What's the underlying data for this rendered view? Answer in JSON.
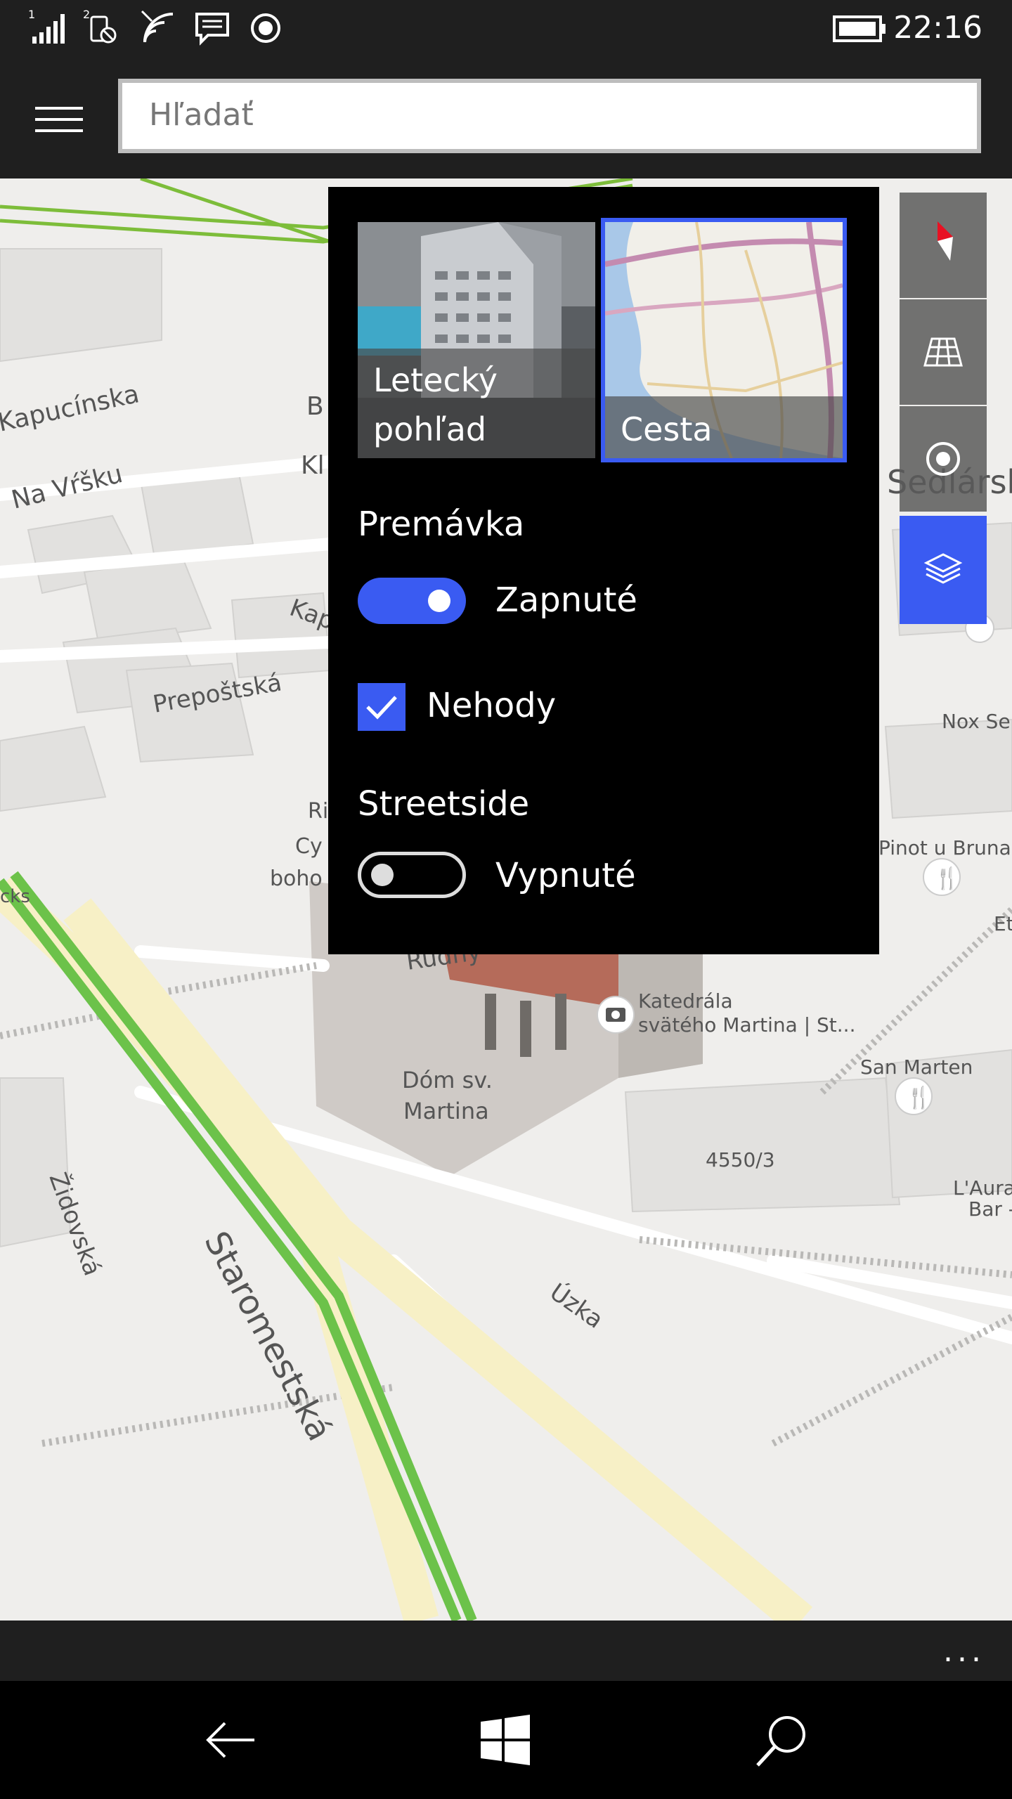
{
  "status": {
    "sim1": "1",
    "sim2": "2",
    "time": "22:16"
  },
  "search": {
    "placeholder": "Hľadať"
  },
  "panel": {
    "tiles": [
      {
        "label_line1": "Letecký",
        "label_line2": "pohľad",
        "selected": false
      },
      {
        "label": "Cesta",
        "selected": true
      }
    ],
    "traffic": {
      "title": "Premávka",
      "toggle_state": "on",
      "toggle_label": "Zapnuté"
    },
    "incidents": {
      "label": "Nehody",
      "checked": true
    },
    "streetside": {
      "title": "Streetside",
      "toggle_state": "off",
      "toggle_label": "Vypnuté"
    }
  },
  "map": {
    "labels": [
      "Kapucínska",
      "Na Vŕšku",
      "Prepoštská",
      "Kap",
      "Kl",
      "B",
      "Ri",
      "Cy",
      "boho",
      "cks",
      "Židovská",
      "Staromestská",
      "Úzka",
      "Dóm sv.",
      "Martina",
      "Katedrála",
      "svätého Martina | St...",
      "4550/3",
      "San Marten",
      "L'Aura",
      "Bar -",
      "Pinot u Bruna",
      "Nox Se",
      "Sedlárska",
      "Et",
      "Rudny"
    ]
  },
  "icons": {
    "menu": "hamburger-icon",
    "compass": "compass-icon",
    "tilt": "3d-grid-icon",
    "locate": "locate-icon",
    "layers": "layers-icon",
    "back": "back-arrow-icon",
    "start": "windows-start-icon",
    "search": "search-icon",
    "more": "more-icon"
  },
  "colors": {
    "accent": "#3a5bf2",
    "bar": "#1f1f1f",
    "traffic_green": "#6cc24a",
    "road_yellow": "#f7f0c6"
  },
  "appbar": {
    "more": "..."
  }
}
